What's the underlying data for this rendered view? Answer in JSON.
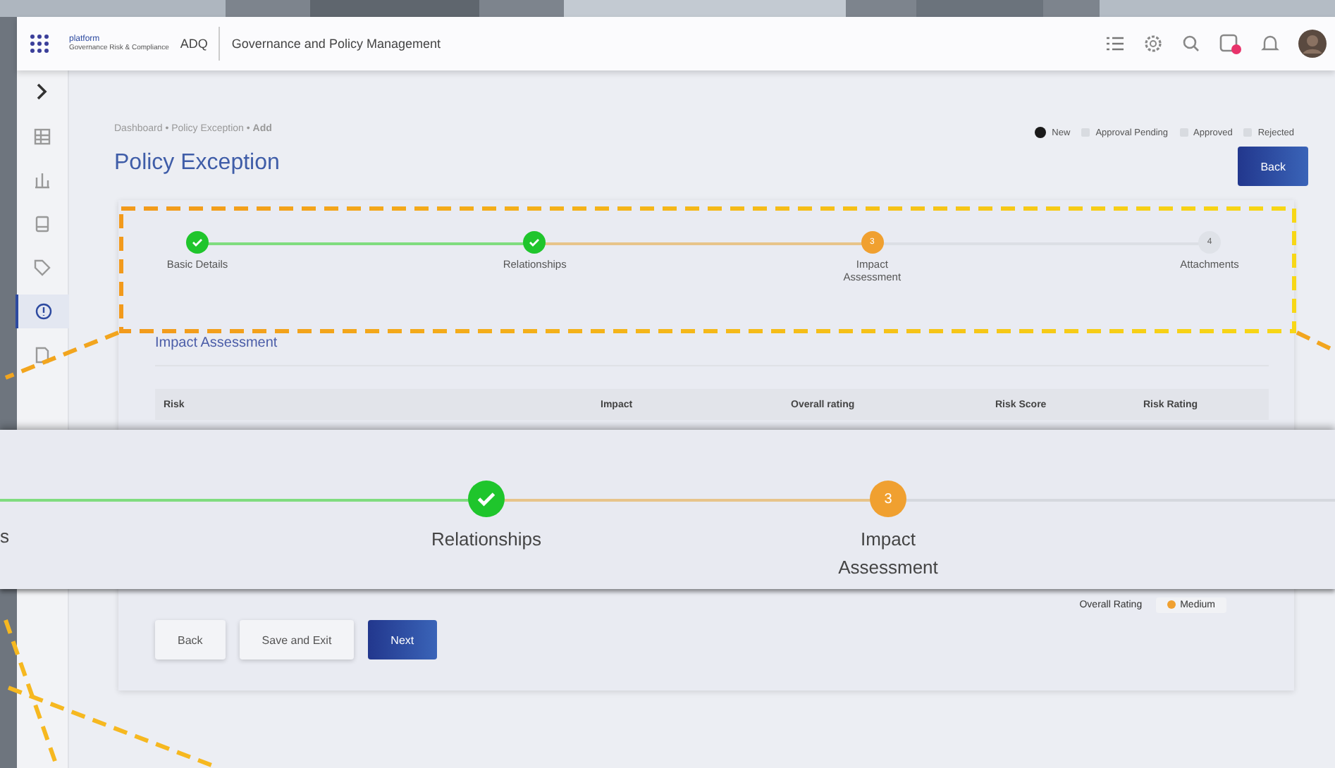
{
  "app_bar": {
    "logo_text": "platform",
    "logo_subtitle": "Governance Risk & Compliance",
    "org": "ADQ",
    "module": "Governance and Policy Management",
    "notification_badge": true
  },
  "sidebar": {
    "items": [
      {
        "kind": "grid",
        "selected": false
      },
      {
        "kind": "chart",
        "selected": false
      },
      {
        "kind": "book",
        "selected": false
      },
      {
        "kind": "tag",
        "selected": false
      },
      {
        "kind": "info",
        "selected": true
      },
      {
        "kind": "doc",
        "selected": false
      }
    ]
  },
  "breadcrumb": "Dashboard • Policy Exception • **Add**",
  "page_title": "Policy Exception",
  "status_legend": [
    {
      "label": "New",
      "active": true
    },
    {
      "label": "Approval Pending",
      "active": false
    },
    {
      "label": "Approved",
      "active": false
    },
    {
      "label": "Rejected",
      "active": false
    }
  ],
  "top_back_button": "Back",
  "stepper": [
    {
      "label": "Basic Details",
      "kind": "done"
    },
    {
      "label": "Relationships",
      "kind": "done"
    },
    {
      "label": "Impact Assessment",
      "kind": "current",
      "number": "3"
    },
    {
      "label": "Attachments",
      "kind": "pending",
      "number": "4"
    }
  ],
  "section_title": "Impact Assessment",
  "table": {
    "columns": [
      "Risk",
      "Impact",
      "Overall rating",
      "Risk Score",
      "Risk Rating"
    ],
    "footer": {
      "label": "Overall Rating",
      "value": "Medium",
      "color": "#f0a030"
    }
  },
  "buttons": [
    {
      "label": "Back",
      "kind": "secondary"
    },
    {
      "label": "Save and Exit",
      "kind": "secondary"
    },
    {
      "label": "Next",
      "kind": "primary"
    }
  ],
  "callout": {
    "cut_label": "s",
    "steps": [
      {
        "label": "Relationships",
        "kind": "done"
      },
      {
        "label": "Impact Assessment",
        "kind": "current",
        "number": "3"
      }
    ]
  }
}
